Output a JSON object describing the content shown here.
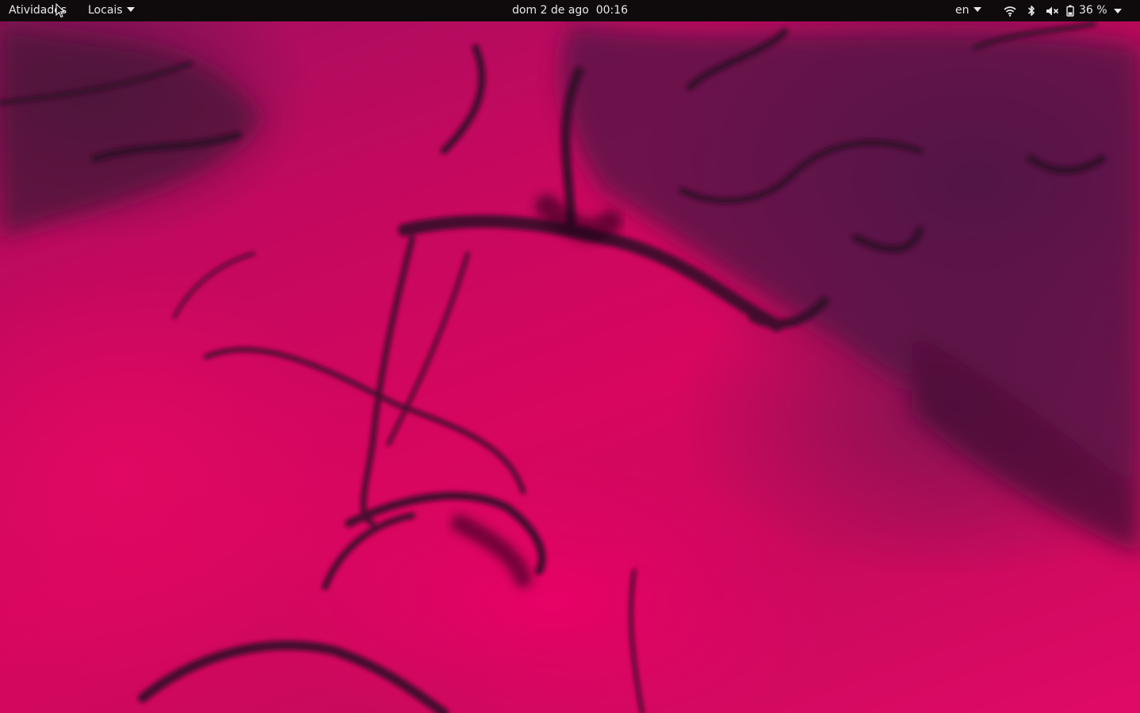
{
  "topbar": {
    "activities_label": "Atividades",
    "places_label": "Locais",
    "clock_text": "dom 2 de ago  00:16",
    "keyboard_layout": "en",
    "battery_percent": "36 %",
    "icons": {
      "wifi": "wifi-icon",
      "bluetooth": "bluetooth-icon",
      "volume": "volume-muted-icon",
      "battery": "battery-icon",
      "menu_arrow": "chevron-down-icon"
    }
  },
  "wallpaper": {
    "description_colors": {
      "base": "#d4075f",
      "smoke": "#3a0f2c",
      "panel": "#0f0b0d"
    }
  }
}
